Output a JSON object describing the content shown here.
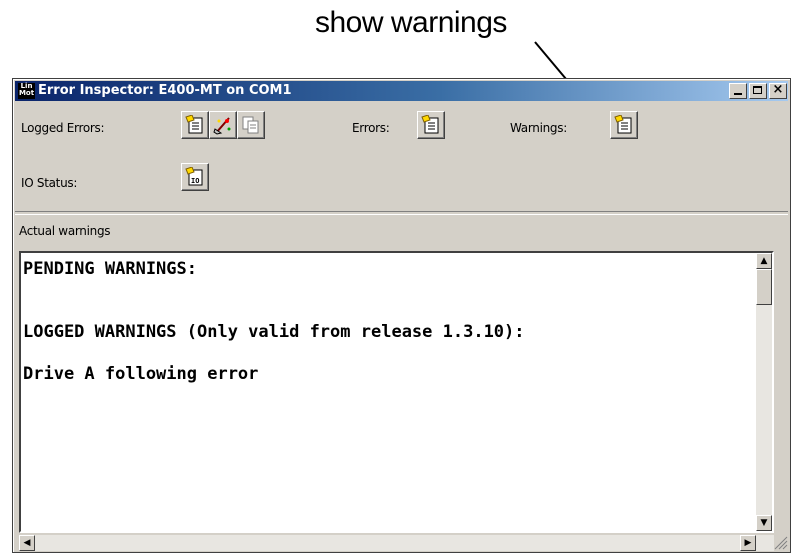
{
  "annotation": {
    "text": "show warnings"
  },
  "window": {
    "title": "Error Inspector: E400-MT on COM1",
    "app_icon_top": "Lin",
    "app_icon_bottom": "Mot",
    "controls": {
      "minimize": "minimize",
      "maximize": "maximize",
      "close": "×"
    }
  },
  "toolbar": {
    "logged_errors_label": "Logged Errors:",
    "errors_label": "Errors:",
    "warnings_label": "Warnings:",
    "io_status_label": "IO Status:",
    "icons": [
      "document-icon",
      "clear-icon",
      "save-icon",
      "errors-document-icon",
      "warnings-document-icon",
      "io-document-icon"
    ]
  },
  "section": {
    "caption": "Actual warnings"
  },
  "output": {
    "lines": [
      "PENDING WARNINGS:",
      "",
      "",
      "LOGGED WARNINGS (Only valid from release 1.3.10):",
      "",
      "Drive A following error"
    ]
  },
  "colors": {
    "titlebar_start": "#0a246a",
    "titlebar_end": "#a6caf0",
    "face": "#d4d0c8"
  }
}
